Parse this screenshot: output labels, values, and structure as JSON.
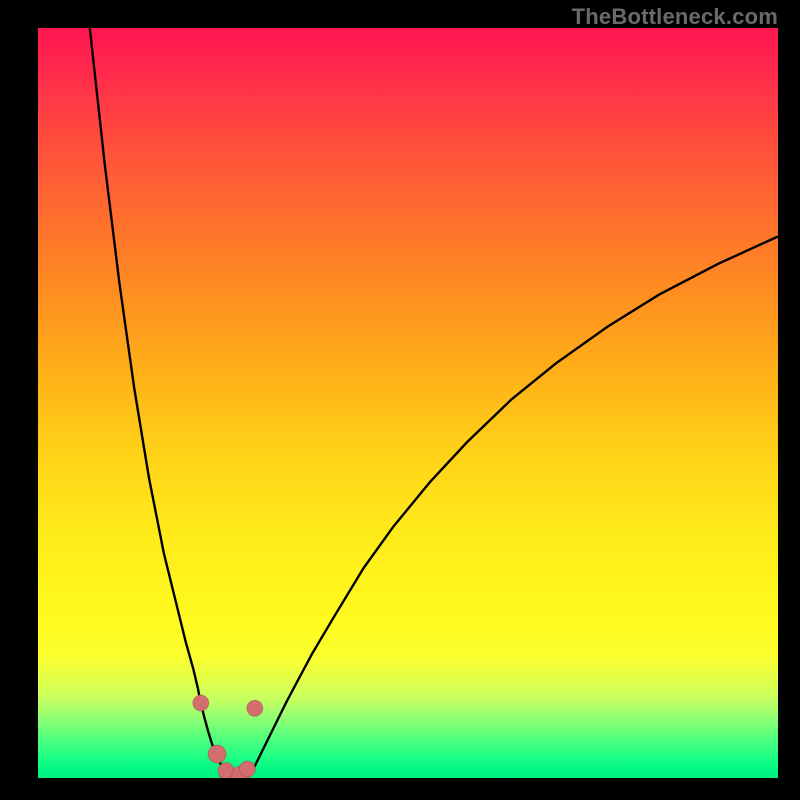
{
  "watermark": "TheBottleneck.com",
  "gradient_colors": {
    "top": "#ff1550",
    "mid": "#ffe81a",
    "bottom": "#00f080"
  },
  "chart_data": {
    "type": "line",
    "title": "",
    "xlabel": "",
    "ylabel": "",
    "xlim": [
      0,
      100
    ],
    "ylim": [
      0,
      100
    ],
    "grid": false,
    "legend": false,
    "series": [
      {
        "name": "left-branch",
        "x": [
          7,
          8,
          9,
          10,
          11,
          12,
          13,
          14,
          15,
          16,
          17,
          18,
          19,
          20,
          21,
          21.6,
          22,
          22.5,
          23,
          23.5,
          24,
          24.5,
          25,
          25.5,
          25.8
        ],
        "y": [
          100,
          91,
          82,
          74,
          66,
          59,
          52,
          46,
          40,
          35,
          30,
          26,
          22,
          18,
          14.5,
          12,
          10,
          8,
          6.2,
          4.6,
          3.2,
          2.2,
          1.3,
          0.6,
          0.2
        ]
      },
      {
        "name": "right-branch",
        "x": [
          28.2,
          28.8,
          29.3,
          30,
          31,
          32,
          33.5,
          35,
          37,
          40,
          44,
          48,
          53,
          58,
          64,
          70,
          77,
          84,
          92,
          100
        ],
        "y": [
          0.2,
          0.8,
          1.6,
          3.0,
          5.0,
          7.0,
          10.0,
          12.8,
          16.5,
          21.5,
          28.0,
          33.5,
          39.5,
          44.8,
          50.5,
          55.3,
          60.2,
          64.5,
          68.6,
          72.2
        ]
      }
    ],
    "points": {
      "name": "markers",
      "x": [
        22.0,
        24.2,
        25.8,
        25.4,
        27.4,
        28.3,
        29.3
      ],
      "y": [
        10.0,
        3.2,
        0.3,
        1.0,
        0.4,
        1.2,
        9.3
      ],
      "r": [
        8,
        9,
        9,
        8,
        9,
        8,
        8
      ]
    },
    "trough_band_y": [
      0,
      3
    ]
  }
}
